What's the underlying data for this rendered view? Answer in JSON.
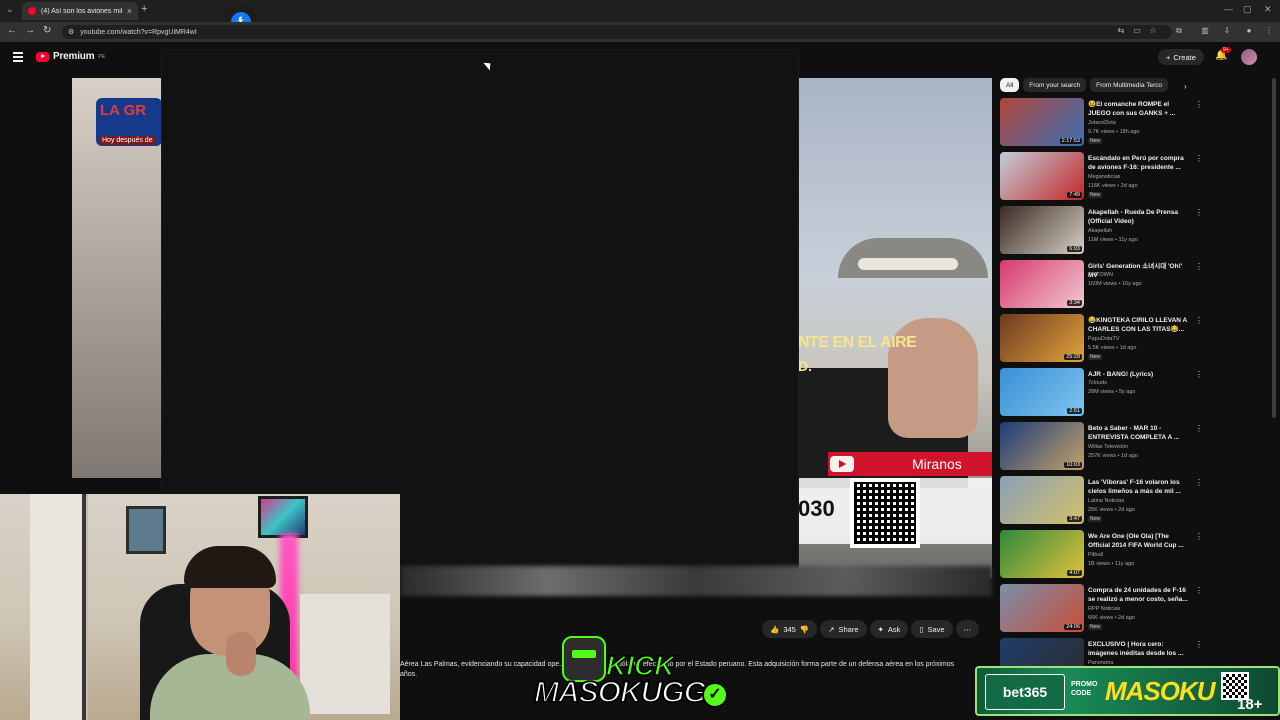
{
  "browser": {
    "tab_title": "(4) Así son los aviones militare",
    "url": "youtube.com/watch?v=RpvgUiMR4wI",
    "tab_close": "×",
    "new_tab": "+"
  },
  "header": {
    "logo_text": "Premium",
    "logo_sup": "PE",
    "create_label": "Create",
    "notif_count": "9+"
  },
  "video": {
    "side_banner_title": "LA GR",
    "side_banner_sub": "Hoy después de",
    "overlay_text_1": "NTE EN EL AIRE",
    "overlay_text_2": "D.",
    "miranos_label": "Miranos",
    "number_text": "030"
  },
  "actions": {
    "like_count": "345",
    "share_label": "Share",
    "ask_label": "Ask",
    "save_label": "Save"
  },
  "description": {
    "text": "Aérea Las Palmas, evidenciando su capacidad ope... 462 millones de dólares efectuado por el Estado peruano. Esta adquisición forma parte de un defensa aérea en los próximos años."
  },
  "sidebar": {
    "chips": [
      "All",
      "From your search",
      "From Multimedia Terco"
    ],
    "recs": [
      {
        "title": "😆El comanche ROMPE el JUEGO con sus GANKS + ...",
        "channel": "JotaceDota",
        "meta": "9.7K views • 18h ago",
        "new": "New",
        "duration": "2:17:53",
        "c1": "#b1463a",
        "c2": "#3b6fb6"
      },
      {
        "title": "Escándalo en Perú por compra de aviones F-16: presidente ...",
        "channel": "Meganoticias",
        "meta": "116K views • 2d ago",
        "new": "New",
        "duration": "7:49",
        "c1": "#c3ccd8",
        "c2": "#c2282a"
      },
      {
        "title": "Akapellah - Rueda De Prensa (Official Video)",
        "channel": "Akapellah",
        "meta": "11M views • 11y ago",
        "new": "",
        "duration": "6:03",
        "c1": "#3b2b24",
        "c2": "#d6d0c4"
      },
      {
        "title": "Girls' Generation 소녀시대 'Oh!' MV",
        "channel": "SMTOWN",
        "meta": "160M views • 16y ago",
        "new": "",
        "duration": "3:34",
        "c1": "#d63a6c",
        "c2": "#f2c8d2"
      },
      {
        "title": "😂KINGTEKA CIRILO LLEVAN A CHARLES CON LAS TITAS😂...",
        "channel": "PapuDotaTV",
        "meta": "5.5K views • 1d ago",
        "new": "New",
        "duration": "25:28",
        "c1": "#6c3a1f",
        "c2": "#e2a33b"
      },
      {
        "title": "AJR - BANG! (Lyrics)",
        "channel": "7clouds",
        "meta": "28M views • 5y ago",
        "new": "",
        "duration": "2:51",
        "c1": "#3a8fd6",
        "c2": "#7ec5f0"
      },
      {
        "title": "Beto a Saber - MAR 10 - ENTREVISTA COMPLETA A ...",
        "channel": "Willax Televisión",
        "meta": "257K views • 1d ago",
        "new": "",
        "duration": "10:03",
        "c1": "#1d3c7a",
        "c2": "#c4a06b"
      },
      {
        "title": "Las 'Víboras' F-16 volaron los cielos limeños a más de mil ...",
        "channel": "Latina Noticias",
        "meta": "25K views • 2d ago",
        "new": "New",
        "duration": "3:47",
        "c1": "#8aa0b5",
        "c2": "#d3c06b"
      },
      {
        "title": "We Are One (Ole Ola) [The Official 2014 FIFA World Cup ...",
        "channel": "Pitbull",
        "meta": "1B views • 11y ago",
        "new": "",
        "duration": "4:07",
        "c1": "#2f8a3b",
        "c2": "#e2c13b"
      },
      {
        "title": "Compra de 24 unidades de F-16 se realizó a menor costo, seña...",
        "channel": "RPP Noticias",
        "meta": "66K views • 2d ago",
        "new": "New",
        "duration": "24:06",
        "c1": "#7a8fa8",
        "c2": "#c84d3a"
      },
      {
        "title": "EXCLUSIVO | Hora cero: imágenes inéditas desde los ...",
        "channel": "Panorama",
        "meta": "1M views • 6y ago",
        "new": "",
        "duration": "20:21",
        "c1": "#1f3d6b",
        "c2": "#2c2c2c"
      }
    ]
  },
  "overlays": {
    "kick_word": "KICK",
    "kick_name": "MASOKUGG",
    "bet_logo": "bet365",
    "bet_promo": "PROMO\nCODE",
    "bet_code": "MASOKU",
    "bet_age": "18+"
  }
}
